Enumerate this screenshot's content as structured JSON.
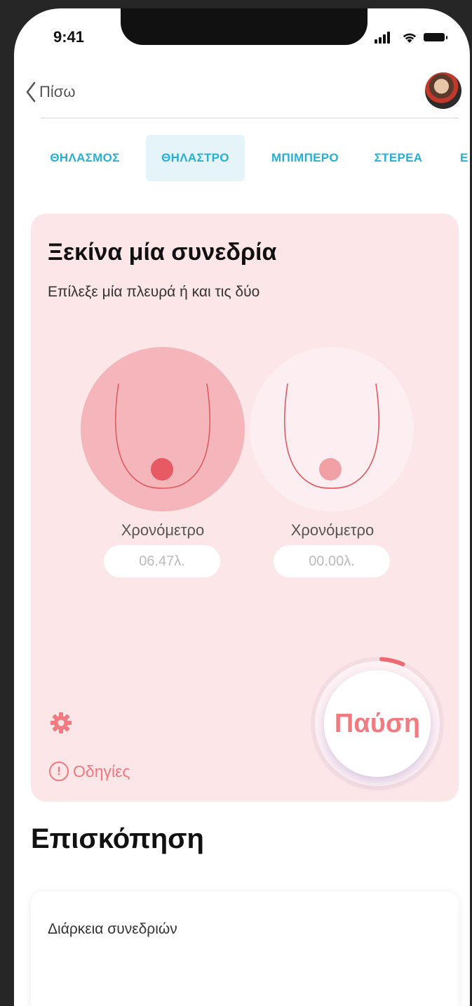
{
  "status_bar": {
    "time": "9:41"
  },
  "nav": {
    "back_label": "Πίσω"
  },
  "tabs": [
    {
      "label": "ΘΗΛΑΣΜΟΣ",
      "active": false
    },
    {
      "label": "ΘΗΛΑΣΤΡΟ",
      "active": true
    },
    {
      "label": "ΜΠΙΜΠΕΡΟ",
      "active": false
    },
    {
      "label": "ΣΤΕΡΕΑ",
      "active": false
    },
    {
      "label": "Ε",
      "active": false
    }
  ],
  "session": {
    "title": "Ξεκίνα μία συνεδρία",
    "subtitle": "Επίλεξε μία πλευρά ή και τις δύο",
    "left": {
      "timer_label": "Χρονόμετρο",
      "timer_value": "06.47λ."
    },
    "right": {
      "timer_label": "Χρονόμετρο",
      "timer_value": "00.00λ."
    },
    "instructions_label": "Οδηγίες",
    "pause_label": "Παύση"
  },
  "overview": {
    "title": "Επισκόπηση",
    "card_label": "Διάρκεια συνεδριών"
  },
  "colors": {
    "accent_pink": "#f27b82",
    "tab_blue": "#27b0d6",
    "card_bg": "#fde6e8"
  }
}
